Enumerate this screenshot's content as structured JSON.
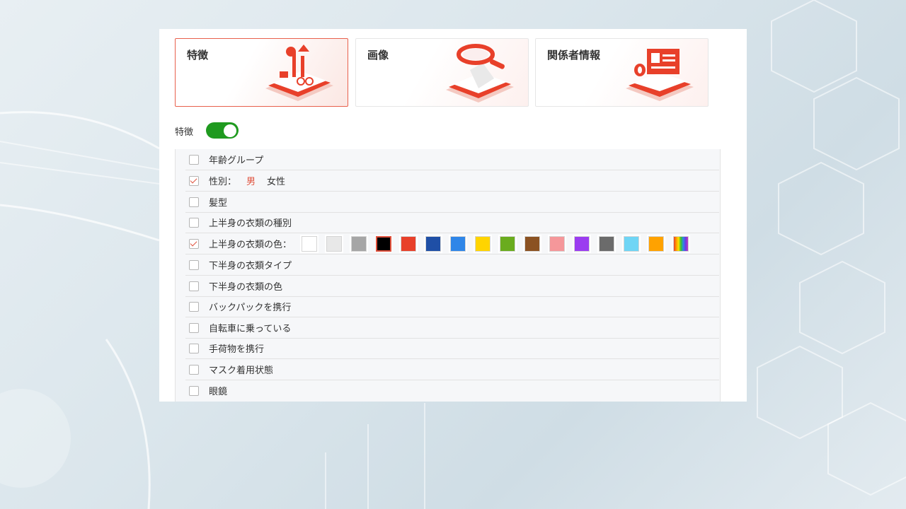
{
  "cards": [
    {
      "title": "特徴",
      "active": true,
      "icon": "person-features-icon"
    },
    {
      "title": "画像",
      "active": false,
      "icon": "magnifier-image-icon"
    },
    {
      "title": "関係者情報",
      "active": false,
      "icon": "id-card-icon"
    }
  ],
  "toggle": {
    "label": "特徴",
    "on": true
  },
  "attributes": [
    {
      "label": "年齢グループ",
      "checked": false
    },
    {
      "label": "性別：",
      "checked": true,
      "options": [
        "男",
        "女性"
      ]
    },
    {
      "label": "髪型",
      "checked": false
    },
    {
      "label": "上半身の衣類の種別",
      "checked": false
    },
    {
      "label": "上半身の衣類の色：",
      "checked": true,
      "colors": true
    },
    {
      "label": "下半身の衣類タイプ",
      "checked": false
    },
    {
      "label": "下半身の衣類の色",
      "checked": false
    },
    {
      "label": "バックパックを携行",
      "checked": false
    },
    {
      "label": "自転車に乗っている",
      "checked": false
    },
    {
      "label": "手荷物を携行",
      "checked": false
    },
    {
      "label": "マスク着用状態",
      "checked": false
    },
    {
      "label": "眼鏡",
      "checked": false
    }
  ],
  "color_swatches": [
    "#ffffff",
    "#e8e8e8",
    "#a6a6a6",
    "#000000",
    "#e8402a",
    "#1f4fa6",
    "#2f86e8",
    "#ffd400",
    "#6aac1e",
    "#8b5222",
    "#f5979a",
    "#9b3cf0",
    "#6b6b6b",
    "#6fd5f5",
    "#ffa200",
    "rainbow"
  ],
  "selected_color_index": 3,
  "accent_color": "#e0513d",
  "toggle_color": "#1f9a1f"
}
